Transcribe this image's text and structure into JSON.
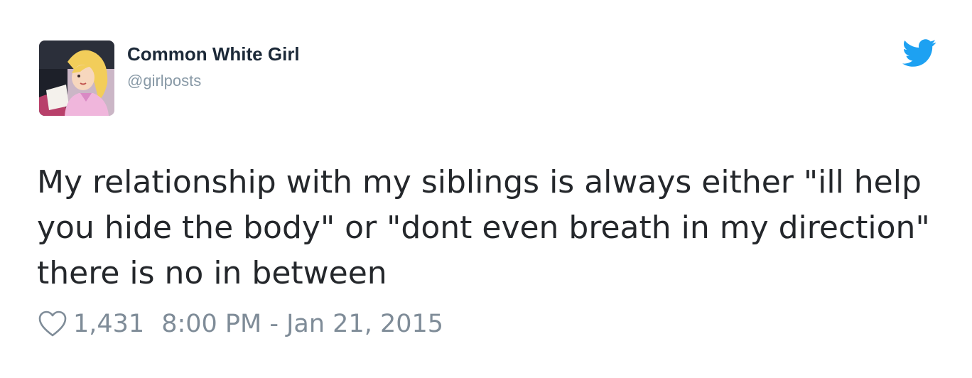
{
  "tweet": {
    "author": {
      "display_name": "Common White Girl",
      "handle": "@girlposts"
    },
    "text": "My relationship with my siblings is always either \"ill help you hide the body\" or \"dont even breath in my direction\" there is no in between",
    "likes": "1,431",
    "timestamp": "8:00 PM - Jan 21, 2015"
  },
  "icons": {
    "brand": "twitter-bird-icon",
    "like": "heart-icon"
  },
  "colors": {
    "twitter_blue": "#1da1f2",
    "text": "#24272b",
    "muted": "#8899a6"
  }
}
